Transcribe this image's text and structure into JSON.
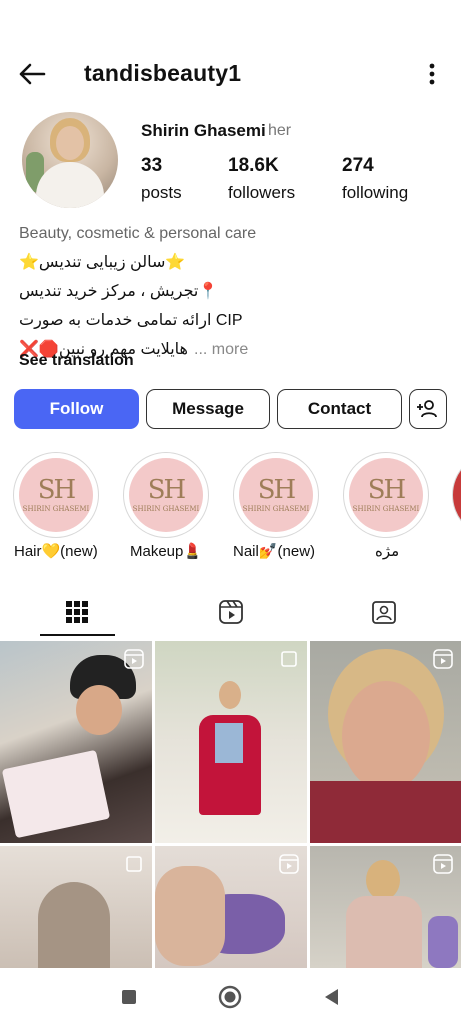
{
  "header": {
    "username": "tandisbeauty1",
    "back_icon": "arrow-left-icon",
    "menu_icon": "more-vertical-icon"
  },
  "profile": {
    "display_name": "Shirin Ghasemi",
    "pronoun": "her",
    "stats": [
      {
        "value": "33",
        "label": "posts"
      },
      {
        "value": "18.6K",
        "label": "followers"
      },
      {
        "value": "274",
        "label": "following"
      }
    ],
    "category": "Beauty, cosmetic & personal care",
    "bio_line1": "⭐سالن زیبایی تندیس⭐",
    "bio_line2": "📍تجریش ، مرکز خرید تندیس",
    "bio_line3": "CIP ارائه تمامی خدمات  به صورت",
    "bio_line4": "هایلایت مهم رو نبین🛑❌",
    "bio_more": "... more",
    "see_translation": "See translation"
  },
  "actions": {
    "follow": "Follow",
    "message": "Message",
    "contact": "Contact",
    "add_user_icon": "add-person-icon"
  },
  "highlights": [
    {
      "label": "Hair💛(new)",
      "logo_initials": "SH",
      "logo_name": "SHIRIN GHASEMI"
    },
    {
      "label": "Makeup💄",
      "logo_initials": "SH",
      "logo_name": "SHIRIN GHASEMI"
    },
    {
      "label": "Nail💅(new)",
      "logo_initials": "SH",
      "logo_name": "SHIRIN GHASEMI"
    },
    {
      "label": "مژه",
      "logo_initials": "SH",
      "logo_name": "SHIRIN GHASEMI"
    }
  ],
  "tabs": [
    {
      "name": "grid-icon",
      "active": true
    },
    {
      "name": "reels-icon",
      "active": false
    },
    {
      "name": "tagged-icon",
      "active": false
    }
  ],
  "colors": {
    "follow_button": "#4a66f4",
    "highlight_bg": "#f3c9c9",
    "highlight_logo": "#9e7d58"
  },
  "navbar": [
    "recent-apps-icon",
    "home-icon",
    "back-icon"
  ]
}
